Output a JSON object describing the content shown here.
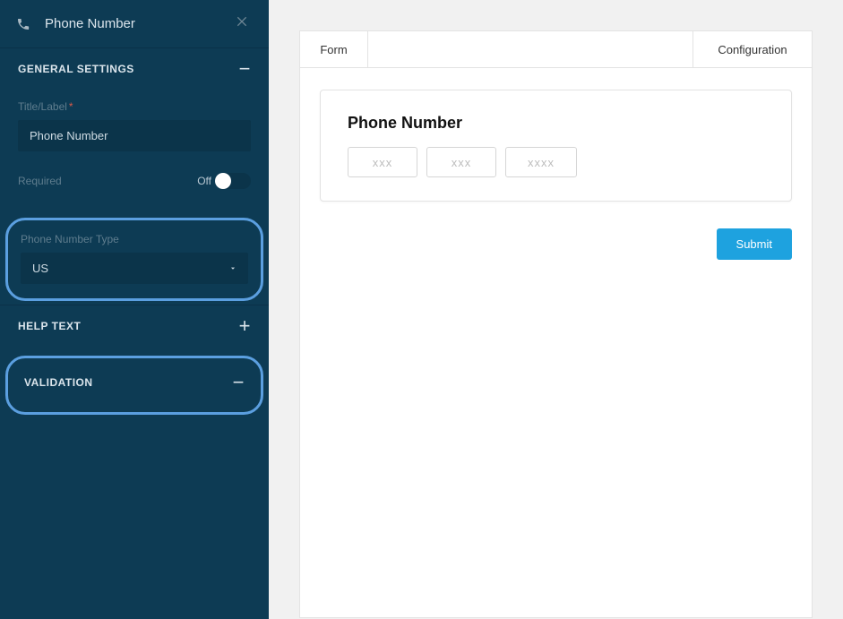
{
  "sidebar": {
    "header": {
      "title": "Phone Number"
    },
    "sections": {
      "general": {
        "heading": "GENERAL SETTINGS",
        "title_label": "Title/Label",
        "title_value": "Phone Number",
        "required_label": "Required",
        "required_state_text": "Off",
        "type_label": "Phone Number Type",
        "type_value": "US"
      },
      "help_text": {
        "heading": "HELP TEXT"
      },
      "validation": {
        "heading": "VALIDATION"
      }
    },
    "toggle_minus": "−",
    "toggle_plus": "+"
  },
  "preview": {
    "tabs": {
      "form": "Form",
      "configuration": "Configuration"
    },
    "card": {
      "title": "Phone Number",
      "ph1": "xxx",
      "ph2": "xxx",
      "ph3": "xxxx"
    },
    "submit_label": "Submit"
  }
}
